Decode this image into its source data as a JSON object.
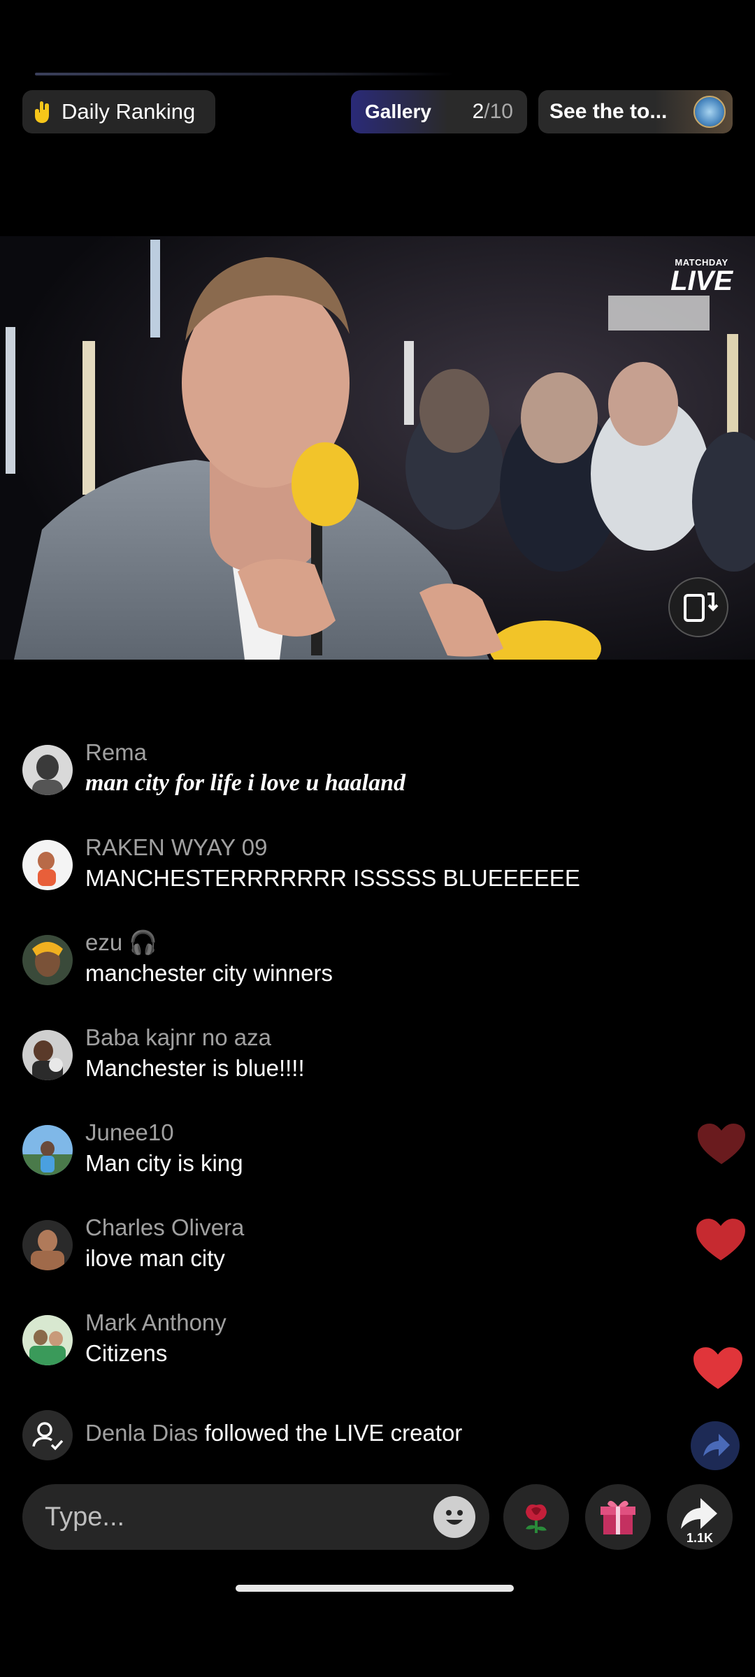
{
  "top": {
    "ranking_label": "Daily Ranking",
    "gallery_label": "Gallery",
    "gallery_current": "2",
    "gallery_total": "/10",
    "see_top_label": "See the to..."
  },
  "video": {
    "watermark_small": "MATCHDAY",
    "watermark_big": "LIVE"
  },
  "comments": [
    {
      "user": "Rema",
      "message": "man city for life i love u haaland"
    },
    {
      "user": "RAKEN WYAY 09",
      "message": "MANCHESTERRRRRRR ISSSSS BLUEEEEEE"
    },
    {
      "user": "ezu 🎧",
      "message": "manchester city winners"
    },
    {
      "user": "Baba kajnr no aza",
      "message": "Manchester is blue!!!!"
    },
    {
      "user": "Junee10",
      "message": "Man city is king"
    },
    {
      "user": "Charles Olivera",
      "message": "ilove man city"
    },
    {
      "user": "Mark Anthony",
      "message": "Citizens"
    }
  ],
  "follow_event": {
    "user": "Denla Dias",
    "text": " followed the LIVE creator"
  },
  "input": {
    "placeholder": "Type..."
  },
  "share": {
    "count": "1.1K"
  },
  "colors": {
    "heart": "#e0353a",
    "heart_dim": "#6a1b1e",
    "gallery_accent": "#2a2a78"
  }
}
